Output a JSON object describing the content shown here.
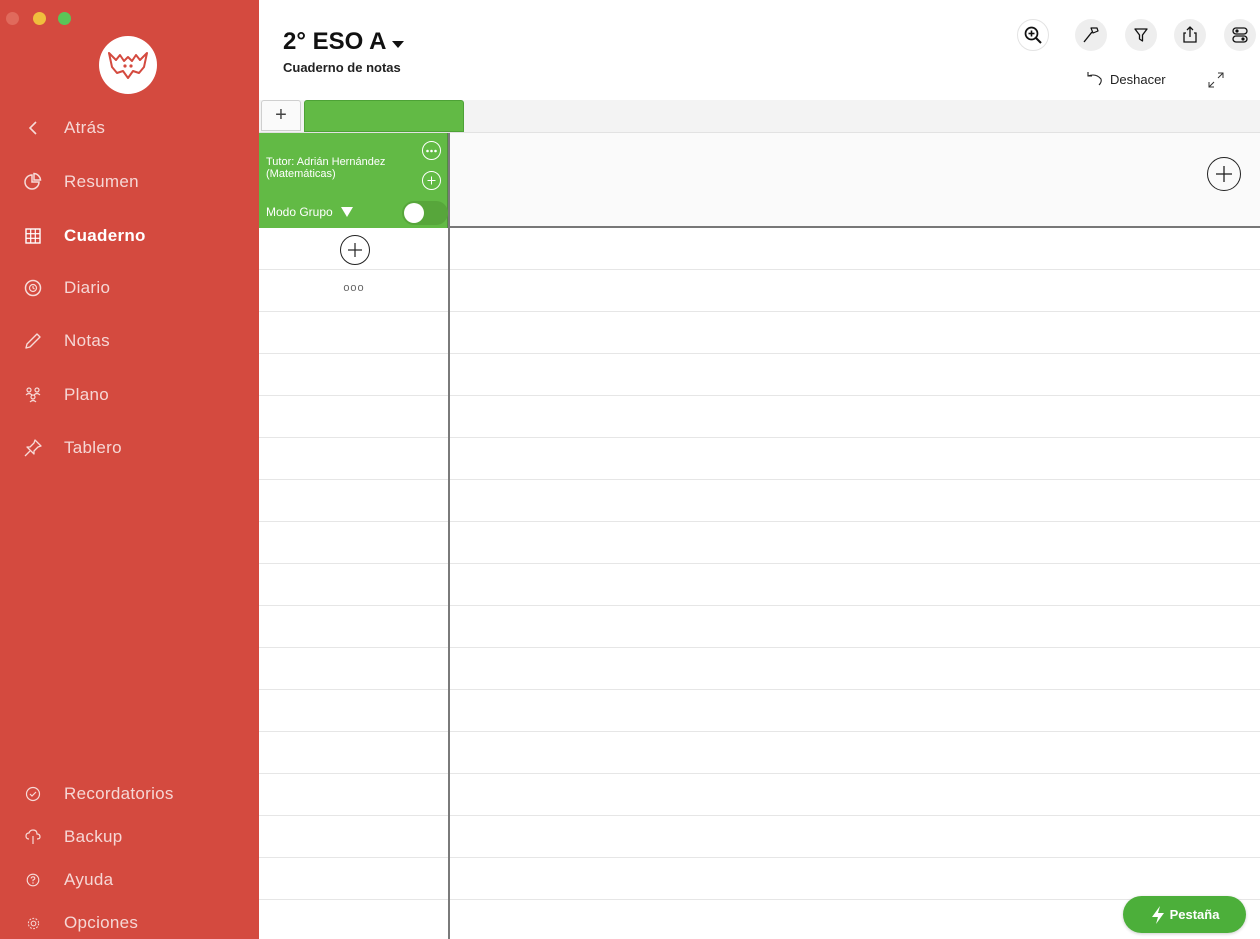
{
  "sidebar": {
    "items": [
      {
        "label": "Atrás",
        "icon": "chevron-left-icon"
      },
      {
        "label": "Resumen",
        "icon": "pie-chart-icon"
      },
      {
        "label": "Cuaderno",
        "icon": "grid-icon"
      },
      {
        "label": "Diario",
        "icon": "clock-bubble-icon"
      },
      {
        "label": "Notas",
        "icon": "pencil-icon"
      },
      {
        "label": "Plano",
        "icon": "people-icon"
      },
      {
        "label": "Tablero",
        "icon": "pin-icon"
      }
    ],
    "bottom_items": [
      {
        "label": "Recordatorios",
        "icon": "check-circle-icon"
      },
      {
        "label": "Backup",
        "icon": "cloud-icon"
      },
      {
        "label": "Ayuda",
        "icon": "help-icon"
      },
      {
        "label": "Opciones",
        "icon": "gear-icon"
      }
    ],
    "active": "Cuaderno",
    "color": "#d44a3f"
  },
  "header": {
    "title": "2° ESO A",
    "subtitle": "Cuaderno de notas",
    "undo_label": "Deshacer",
    "tools": [
      "zoom-in-icon",
      "hammer-icon",
      "filter-icon",
      "share-icon",
      "toggles-icon"
    ]
  },
  "tabs": {
    "add_label": "+",
    "active_tab_color": "#62ba45"
  },
  "group": {
    "tutor": "Tutor: Adrián Hernández (Matemáticas)",
    "mode_label": "Modo Grupo",
    "mode_on": true
  },
  "grid": {
    "dots": "ooo"
  },
  "action_button": {
    "label": "Pestaña"
  }
}
